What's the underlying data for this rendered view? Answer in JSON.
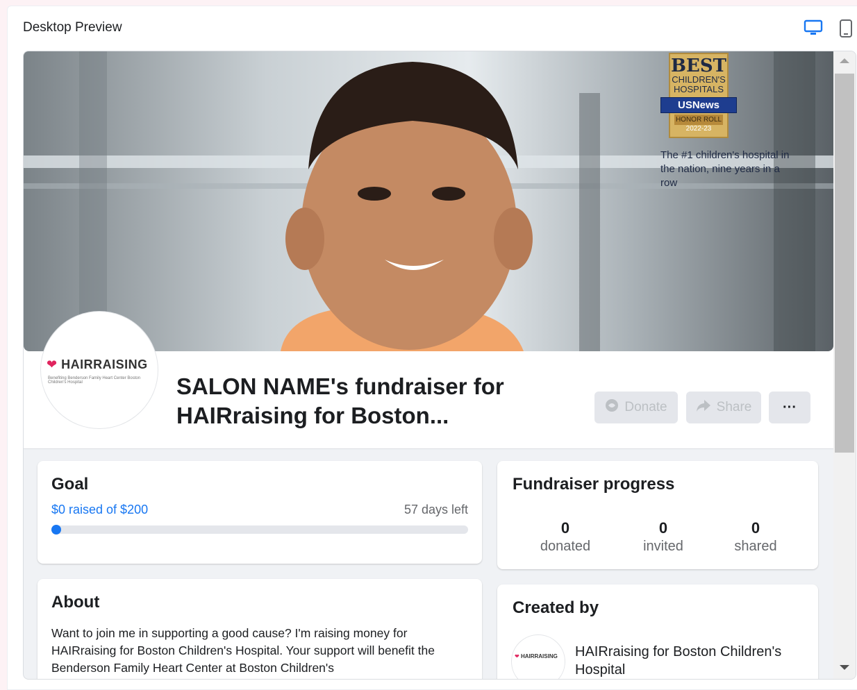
{
  "panel": {
    "title": "Desktop Preview",
    "desktop_icon": "desktop-icon",
    "mobile_icon": "mobile-icon"
  },
  "cover": {
    "badge": {
      "best": "BEST",
      "line1": "CHILDREN'S",
      "line2": "HOSPITALS",
      "ribbon": "USNews",
      "honor": "HONOR ROLL",
      "year": "2022-23"
    },
    "text": "The #1 children's hospital in the nation, nine years in a row"
  },
  "avatar": {
    "name": "HAIRRAISING",
    "sub": "Benefiting  Benderson Family Heart Center  Boston Children's Hospital"
  },
  "title": "SALON NAME's fundraiser for HAIRraising for Boston...",
  "actions": {
    "donate": "Donate",
    "share": "Share",
    "more": "···"
  },
  "goal": {
    "heading": "Goal",
    "raised": "$0 raised of $200",
    "days_left": "57 days left",
    "progress_fraction": 0
  },
  "progress": {
    "heading": "Fundraiser progress",
    "stats": [
      {
        "value": "0",
        "label": "donated"
      },
      {
        "value": "0",
        "label": "invited"
      },
      {
        "value": "0",
        "label": "shared"
      }
    ]
  },
  "about": {
    "heading": "About",
    "text": "Want to join me in supporting a good cause? I'm raising money for HAIRraising for Boston Children's Hospital. Your support will benefit the Benderson Family Heart Center at Boston Children's"
  },
  "created": {
    "heading": "Created by",
    "mini_logo": "HAIRRAISING",
    "name": "HAIRraising for Boston Children's Hospital"
  },
  "colors": {
    "accent": "#1877f2",
    "muted": "#65676b",
    "button_bg": "#e4e6eb",
    "heart": "#e0245e"
  }
}
